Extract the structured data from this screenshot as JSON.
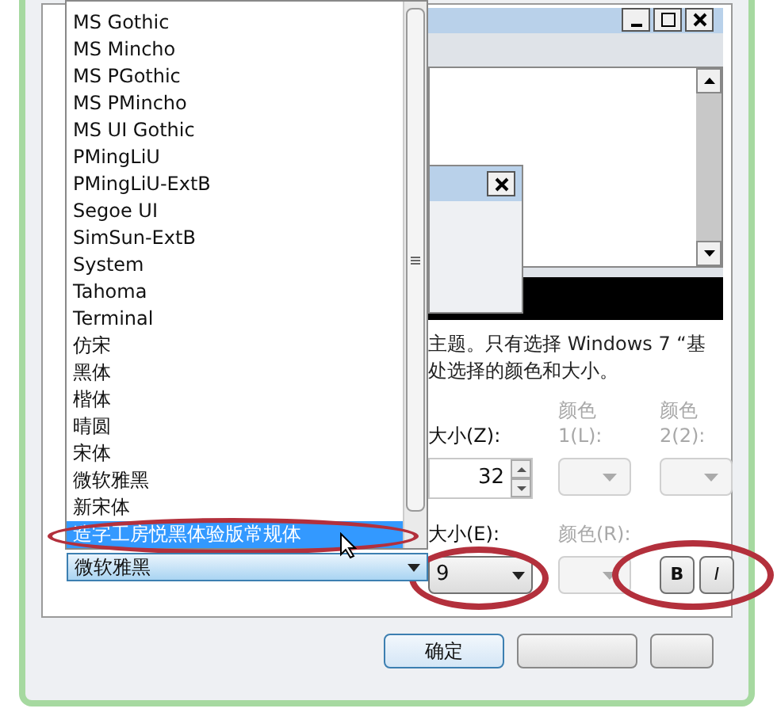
{
  "font_list": {
    "items": [
      {
        "label": "MS Gothic",
        "selected": false
      },
      {
        "label": "MS Mincho",
        "selected": false
      },
      {
        "label": "MS PGothic",
        "selected": false
      },
      {
        "label": "MS PMincho",
        "selected": false
      },
      {
        "label": "MS UI Gothic",
        "selected": false
      },
      {
        "label": "PMingLiU",
        "selected": false
      },
      {
        "label": "PMingLiU-ExtB",
        "selected": false
      },
      {
        "label": "Segoe UI",
        "selected": false
      },
      {
        "label": "SimSun-ExtB",
        "selected": false
      },
      {
        "label": "System",
        "selected": false
      },
      {
        "label": "Tahoma",
        "selected": false
      },
      {
        "label": "Terminal",
        "selected": false
      },
      {
        "label": "仿宋",
        "selected": false
      },
      {
        "label": "黑体",
        "selected": false
      },
      {
        "label": "楷体",
        "selected": false
      },
      {
        "label": "晴圆",
        "selected": false
      },
      {
        "label": "宋体",
        "selected": false
      },
      {
        "label": "微软雅黑",
        "selected": false
      },
      {
        "label": "新宋体",
        "selected": false
      },
      {
        "label": "造字工房悦黑体验版常规体",
        "selected": true
      }
    ]
  },
  "font_combo": {
    "value": "微软雅黑"
  },
  "description": [
    "主题。只有选择 Windows 7 “基",
    "处选择的颜色和大小。"
  ],
  "size": {
    "label": "大小(Z):",
    "value": "32"
  },
  "color1": {
    "label": [
      "颜色",
      "1(L):"
    ],
    "disabled": true
  },
  "color2": {
    "label": [
      "颜色",
      "2(2):"
    ],
    "disabled": true
  },
  "item_size": {
    "label": "大小(E):",
    "value": "9"
  },
  "item_color": {
    "label": "颜色(R):",
    "disabled": true
  },
  "bold": {
    "label": "B",
    "pressed": false
  },
  "italic": {
    "label": "I",
    "pressed": false
  },
  "buttons": [
    {
      "label": "确定",
      "default": true
    }
  ]
}
